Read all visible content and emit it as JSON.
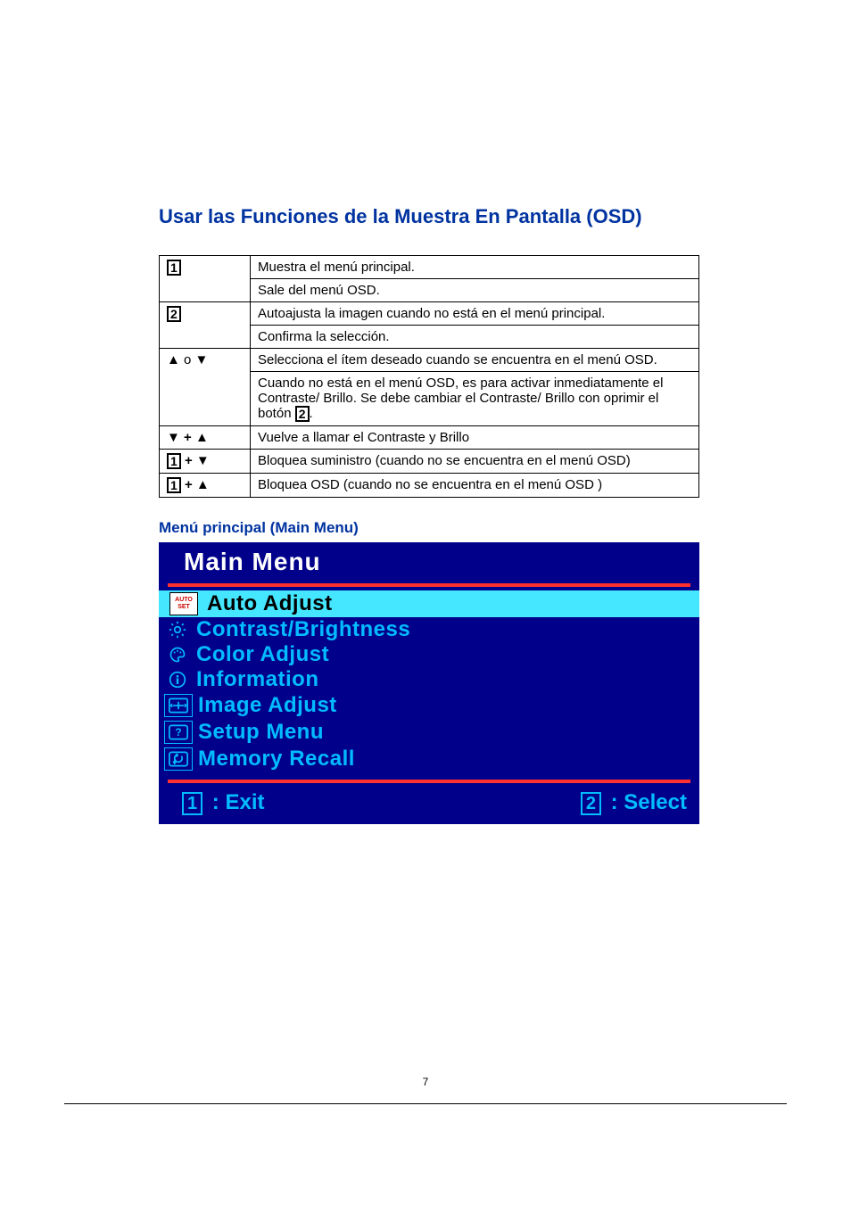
{
  "heading": "Usar las Funciones de la Muestra En Pantalla (OSD)",
  "table": {
    "rows": [
      {
        "key_type": "box",
        "key_value": "1",
        "desc": "Muestra el menú principal."
      },
      {
        "key_type": "blank",
        "key_value": "",
        "desc": "Sale del menú OSD."
      },
      {
        "key_type": "box",
        "key_value": "2",
        "desc": "Autoajusta la imagen cuando no está en el menú principal."
      },
      {
        "key_type": "blank",
        "key_value": "",
        "desc": "Confirma la selección."
      },
      {
        "key_type": "updown-o",
        "key_value": "o",
        "desc": "Selecciona el ítem deseado cuando se encuentra en el menú OSD."
      },
      {
        "key_type": "blank",
        "key_value": "",
        "desc_prefix": "Cuando no está en el menú OSD, es para activar inmediatamente el Contraste/ Brillo. Se debe cambiar el Contraste/ Brillo con oprimir el botón ",
        "desc_box": "2",
        "desc_suffix": "."
      },
      {
        "key_type": "down-plus-up",
        "key_value": "+",
        "desc": "Vuelve a llamar el Contraste y Brillo"
      },
      {
        "key_type": "box-plus-down",
        "key_value": "1",
        "desc": "Bloquea suministro (cuando no se encuentra en el menú OSD)"
      },
      {
        "key_type": "box-plus-up",
        "key_value": "1",
        "desc": "Bloquea OSD (cuando no se encuentra en el menú OSD )"
      }
    ]
  },
  "subheading": "Menú principal (Main Menu)",
  "osd": {
    "title": "Main Menu",
    "items": [
      {
        "icon": "auto-set",
        "label": "Auto Adjust",
        "selected": true
      },
      {
        "icon": "brightness",
        "label": "Contrast/Brightness",
        "selected": false
      },
      {
        "icon": "color",
        "label": "Color Adjust",
        "selected": false
      },
      {
        "icon": "info",
        "label": "Information",
        "selected": false
      },
      {
        "icon": "image",
        "label": "Image Adjust",
        "selected": false
      },
      {
        "icon": "setup",
        "label": "Setup Menu",
        "selected": false
      },
      {
        "icon": "recall",
        "label": "Memory Recall",
        "selected": false
      }
    ],
    "auto_set_top": "AUTO",
    "auto_set_bot": "SET",
    "footer_left_num": "1",
    "footer_left_label": ": Exit",
    "footer_right_num": "2",
    "footer_right_label": ": Select"
  },
  "page_number": "7"
}
